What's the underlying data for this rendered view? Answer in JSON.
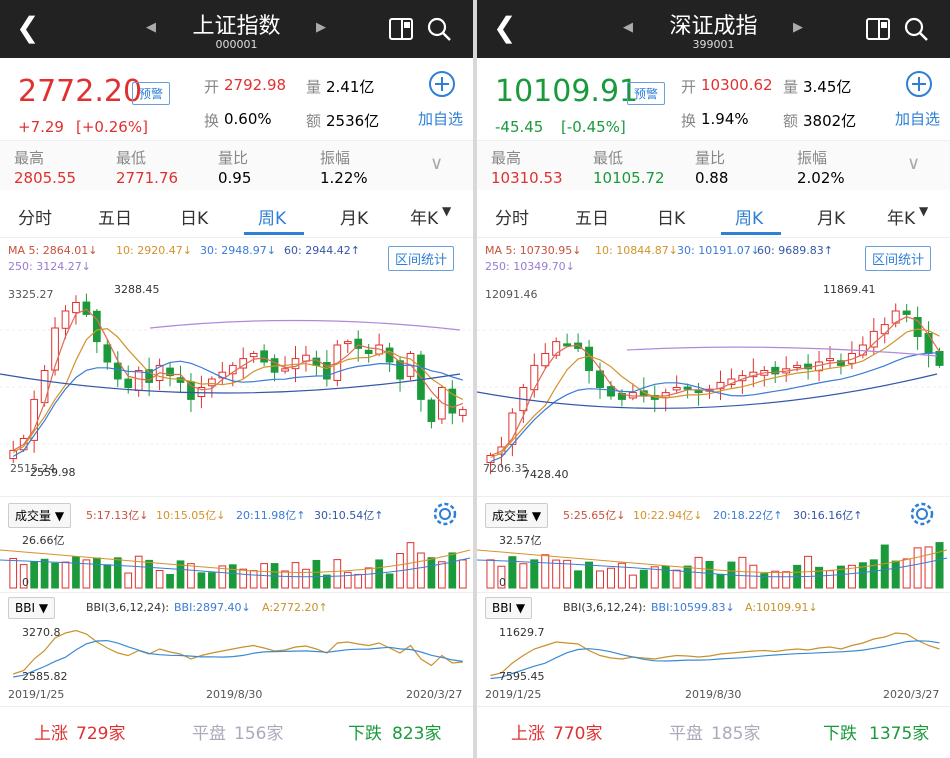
{
  "panels": [
    {
      "title": "上证指数",
      "code": "000001",
      "price": "2772.20",
      "change": "+7.29",
      "pct": "[+0.26%]",
      "alert": "预警",
      "open_label": "开",
      "open": "2792.98",
      "vol_label": "量",
      "vol": "2.41亿",
      "turn_label": "换",
      "turn": "0.60%",
      "amt_label": "额",
      "amt": "2536亿",
      "add_label": "加自选",
      "high_label": "最高",
      "high": "2805.55",
      "low_label": "最低",
      "low": "2771.76",
      "vr_label": "量比",
      "vr": "0.95",
      "amp_label": "振幅",
      "amp": "1.22%",
      "tabs": [
        "分时",
        "五日",
        "日K",
        "周K",
        "月K",
        "年K"
      ],
      "ma5": "MA 5: 2864.01↓",
      "ma10": "10: 2920.47↓",
      "ma30": "30: 2948.97↓",
      "ma60": "60: 2944.42↑",
      "ma250": "250: 3124.27↓",
      "range_btn": "区间统计",
      "y_top": "3325.27",
      "peak": "3288.45",
      "y_bottom": "2515.24",
      "trough": "2559.98",
      "vol_btn": "成交量",
      "v5": "5:17.13亿↓",
      "v10": "10:15.05亿↓",
      "v20": "20:11.98亿↑",
      "v30": "30:10.54亿↑",
      "vol_max": "26.66亿",
      "vol_zero": "0",
      "bbi_btn": "BBI",
      "bbi_param": "BBI(3,6,12,24):",
      "bbi_val": "BBI:2897.40↓",
      "bbi_a": "A:2772.20↑",
      "bbi_top": "3270.8",
      "bbi_bottom": "2585.82",
      "date1": "2019/1/25",
      "date2": "2019/8/30",
      "date3": "2020/3/27",
      "up_label": "上涨",
      "up": "729家",
      "flat_label": "平盘",
      "flat": "156家",
      "down_label": "下跌",
      "down": "823家"
    },
    {
      "title": "深证成指",
      "code": "399001",
      "price": "10109.91",
      "change": "-45.45",
      "pct": "[-0.45%]",
      "alert": "预警",
      "open_label": "开",
      "open": "10300.62",
      "vol_label": "量",
      "vol": "3.45亿",
      "turn_label": "换",
      "turn": "1.94%",
      "amt_label": "额",
      "amt": "3802亿",
      "add_label": "加自选",
      "high_label": "最高",
      "high": "10310.53",
      "low_label": "最低",
      "low": "10105.72",
      "vr_label": "量比",
      "vr": "0.88",
      "amp_label": "振幅",
      "amp": "2.02%",
      "tabs": [
        "分时",
        "五日",
        "日K",
        "周K",
        "月K",
        "年K"
      ],
      "ma5": "MA 5: 10730.95↓",
      "ma10": "10: 10844.87↓",
      "ma30": "30: 10191.07↓",
      "ma60": "60: 9689.83↑",
      "ma250": "250: 10349.70↓",
      "range_btn": "区间统计",
      "y_top": "12091.46",
      "peak": "11869.41",
      "y_bottom": "7206.35",
      "trough": "7428.40",
      "vol_btn": "成交量",
      "v5": "5:25.65亿↓",
      "v10": "10:22.94亿↓",
      "v20": "20:18.22亿↑",
      "v30": "30:16.16亿↑",
      "vol_max": "32.57亿",
      "vol_zero": "0",
      "bbi_btn": "BBI",
      "bbi_param": "BBI(3,6,12,24):",
      "bbi_val": "BBI:10599.83↓",
      "bbi_a": "A:10109.91↓",
      "bbi_top": "11629.7",
      "bbi_bottom": "7595.45",
      "date1": "2019/1/25",
      "date2": "2019/8/30",
      "date3": "2020/3/27",
      "up_label": "上涨",
      "up": "770家",
      "flat_label": "平盘",
      "flat": "185家",
      "down_label": "下跌",
      "down": "1375家"
    }
  ],
  "colors": {
    "up": "#e03030",
    "down": "#1a9a3a",
    "accent": "#2e7fd6"
  }
}
